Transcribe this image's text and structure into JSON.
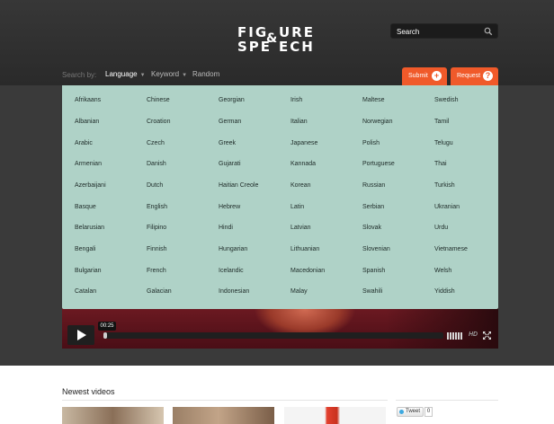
{
  "logo": {
    "line1a": "FIG",
    "line1b": "URE",
    "line2a": "SPE",
    "line2b": "ECH",
    "amp": "&"
  },
  "search": {
    "placeholder": "Search"
  },
  "nav": {
    "search_by_label": "Search by:",
    "items": [
      {
        "label": "Language",
        "has_caret": true,
        "active": true
      },
      {
        "label": "Keyword",
        "has_caret": true,
        "active": false
      },
      {
        "label": "Random",
        "has_caret": false,
        "active": false
      }
    ]
  },
  "buttons": {
    "submit": {
      "label": "Submit",
      "icon": "+"
    },
    "request": {
      "label": "Request",
      "icon": "?"
    }
  },
  "languages": [
    [
      "Afrikaans",
      "Albanian",
      "Arabic",
      "Armenian",
      "Azerbaijani",
      "Basque",
      "Belarusian",
      "Bengali",
      "Bulgarian",
      "Catalan"
    ],
    [
      "Chinese",
      "Croation",
      "Czech",
      "Danish",
      "Dutch",
      "English",
      "Filipino",
      "Finnish",
      "French",
      "Galacian"
    ],
    [
      "Georgian",
      "German",
      "Greek",
      "Gujarati",
      "Haitian Creole",
      "Hebrew",
      "Hindi",
      "Hungarian",
      "Icelandic",
      "Indonesian"
    ],
    [
      "Irish",
      "Italian",
      "Japanese",
      "Kannada",
      "Korean",
      "Latin",
      "Latvian",
      "Lithuanian",
      "Macedonian",
      "Malay"
    ],
    [
      "Maltese",
      "Norwegian",
      "Polish",
      "Portuguese",
      "Russian",
      "Serbian",
      "Slovak",
      "Slovenian",
      "Spanish",
      "Swahili"
    ],
    [
      "Swedish",
      "Tamil",
      "Telugu",
      "Thai",
      "Turkish",
      "Ukranian",
      "Urdu",
      "Vietnamese",
      "Welsh",
      "Yiddish"
    ]
  ],
  "player": {
    "time": "00:25",
    "progress": 0.01,
    "hd_label": "HD"
  },
  "newest": {
    "title": "Newest videos"
  },
  "social": {
    "tweet_label": "Tweet",
    "tweet_count": "0"
  },
  "colors": {
    "accent": "#f05a2a",
    "dropdown_bg": "#afd2c7",
    "header_bg": "#333333"
  }
}
